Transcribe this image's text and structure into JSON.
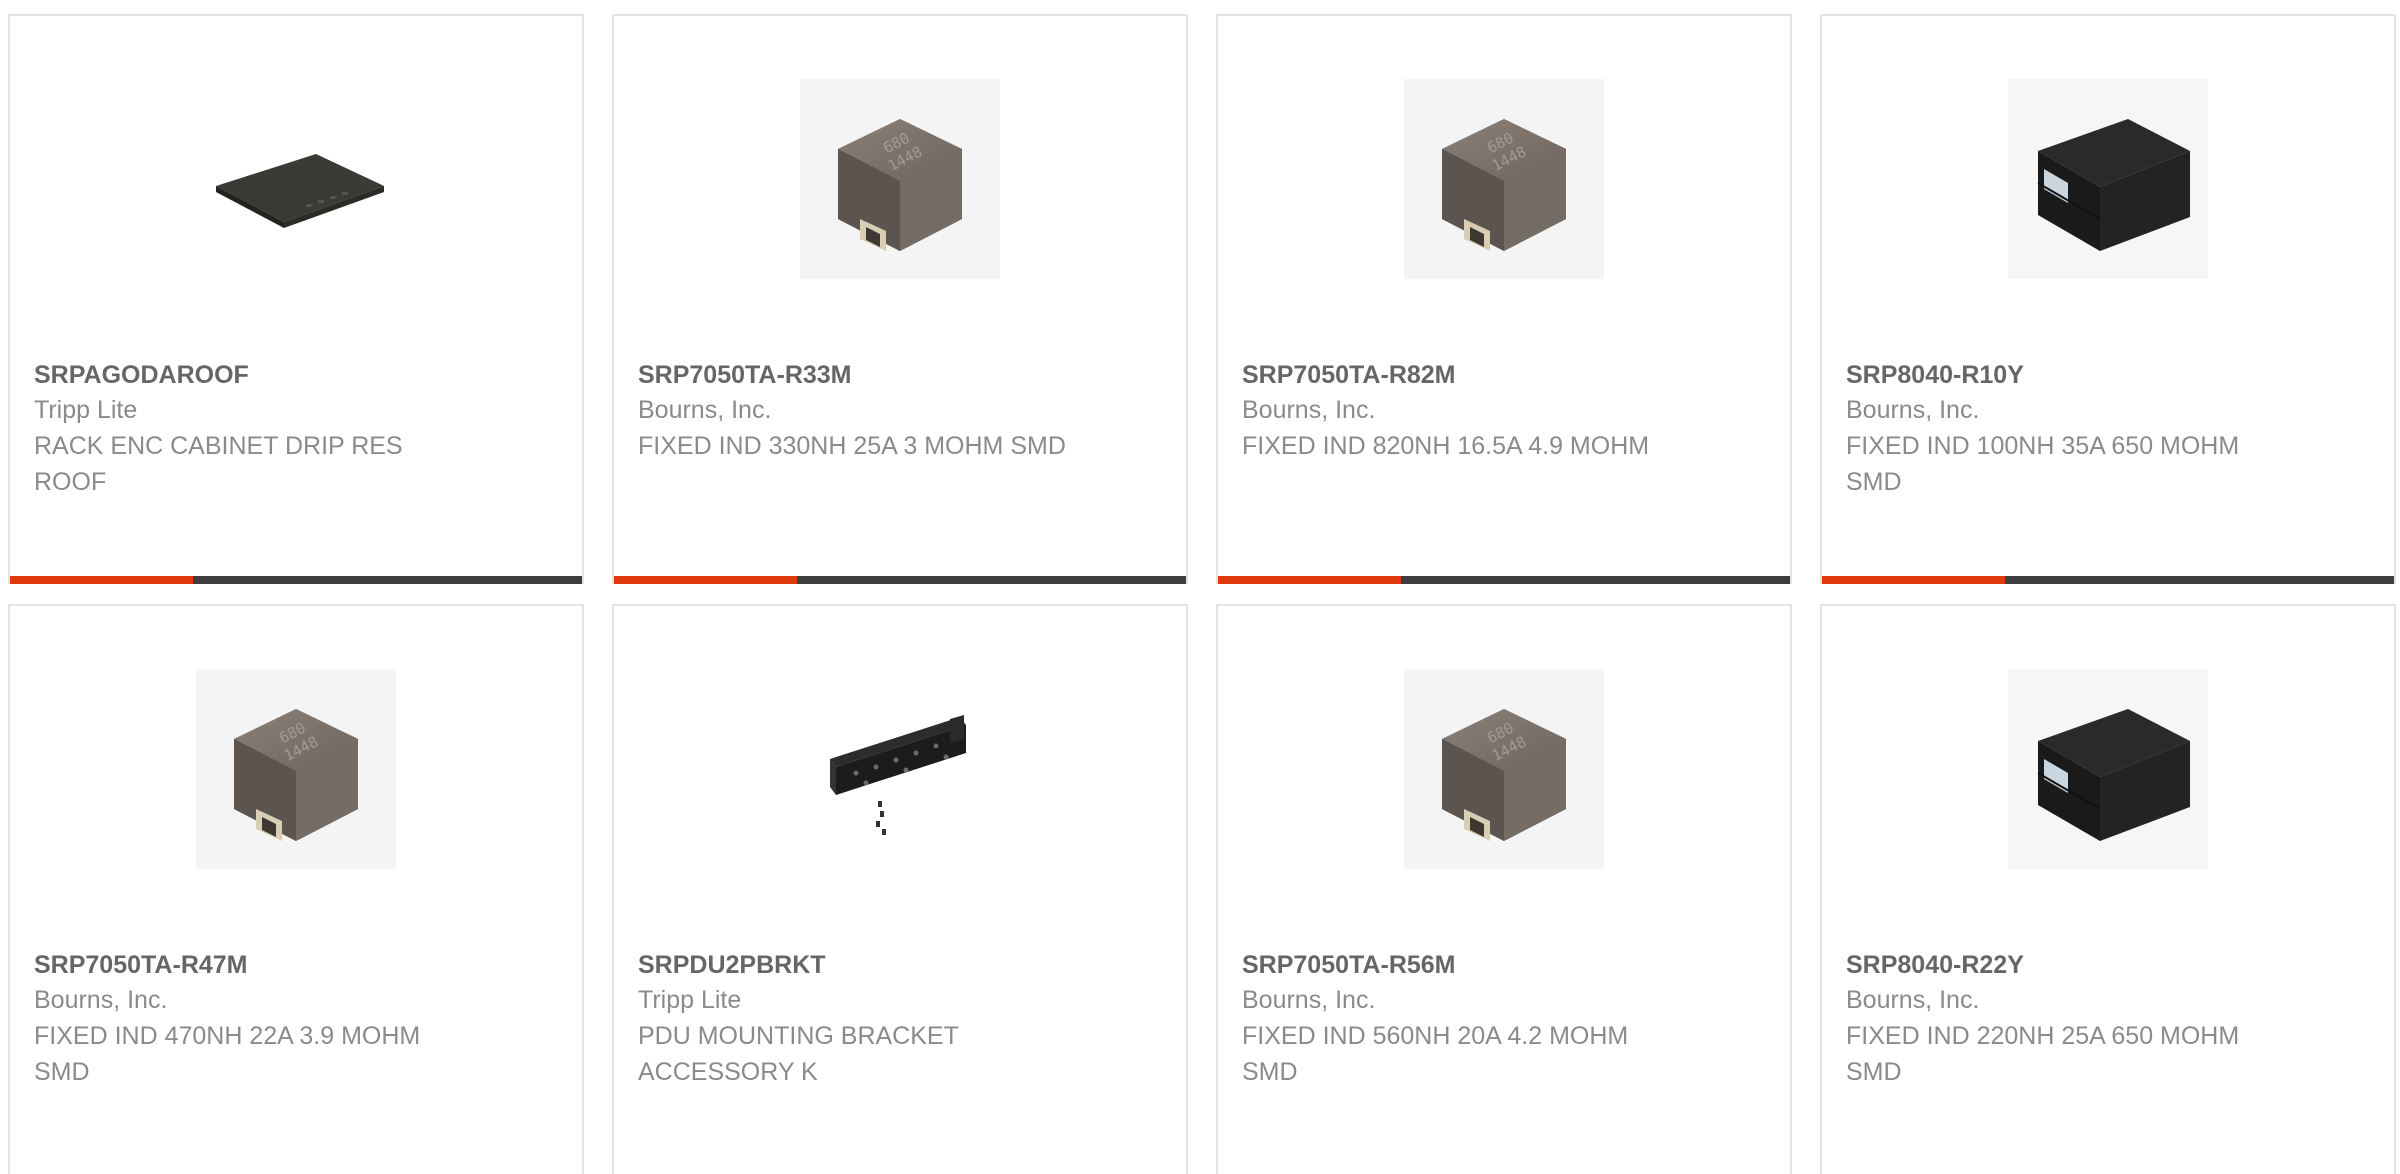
{
  "products": [
    {
      "part": "SRPAGODAROOF",
      "manufacturer": "Tripp Lite",
      "description": "RACK ENC CABINET DRIP RES ROOF",
      "image": "roof-panel-image"
    },
    {
      "part": "SRP7050TA-R33M",
      "manufacturer": "Bourns, Inc.",
      "description": "FIXED IND 330NH 25A 3 MOHM SMD",
      "image": "inductor-image",
      "marking": [
        "680",
        "1448"
      ]
    },
    {
      "part": "SRP7050TA-R82M",
      "manufacturer": "Bourns, Inc.",
      "description": "FIXED IND 820NH 16.5A 4.9 MOHM",
      "image": "inductor-image",
      "marking": [
        "680",
        "1448"
      ]
    },
    {
      "part": "SRP8040-R10Y",
      "manufacturer": "Bourns, Inc.",
      "description": "FIXED IND 100NH 35A 650 MOHM SMD",
      "image": "black-inductor-image"
    },
    {
      "part": "SRP7050TA-R47M",
      "manufacturer": "Bourns, Inc.",
      "description": "FIXED IND 470NH 22A 3.9 MOHM SMD",
      "image": "inductor-image",
      "marking": [
        "680",
        "1448"
      ]
    },
    {
      "part": "SRPDU2PBRKT",
      "manufacturer": "Tripp Lite",
      "description": "PDU MOUNTING BRACKET ACCESSORY K",
      "image": "bracket-image"
    },
    {
      "part": "SRP7050TA-R56M",
      "manufacturer": "Bourns, Inc.",
      "description": "FIXED IND 560NH 20A 4.2 MOHM SMD",
      "image": "inductor-image",
      "marking": [
        "680",
        "1448"
      ]
    },
    {
      "part": "SRP8040-R22Y",
      "manufacturer": "Bourns, Inc.",
      "description": "FIXED IND 220NH 25A 650 MOHM SMD",
      "image": "black-inductor-image"
    }
  ],
  "colors": {
    "accent": "#e0390f",
    "bar": "#3d3d3d",
    "part_text": "#666666",
    "secondary_text": "#8a8a8a",
    "card_border": "#e3e3e3"
  }
}
